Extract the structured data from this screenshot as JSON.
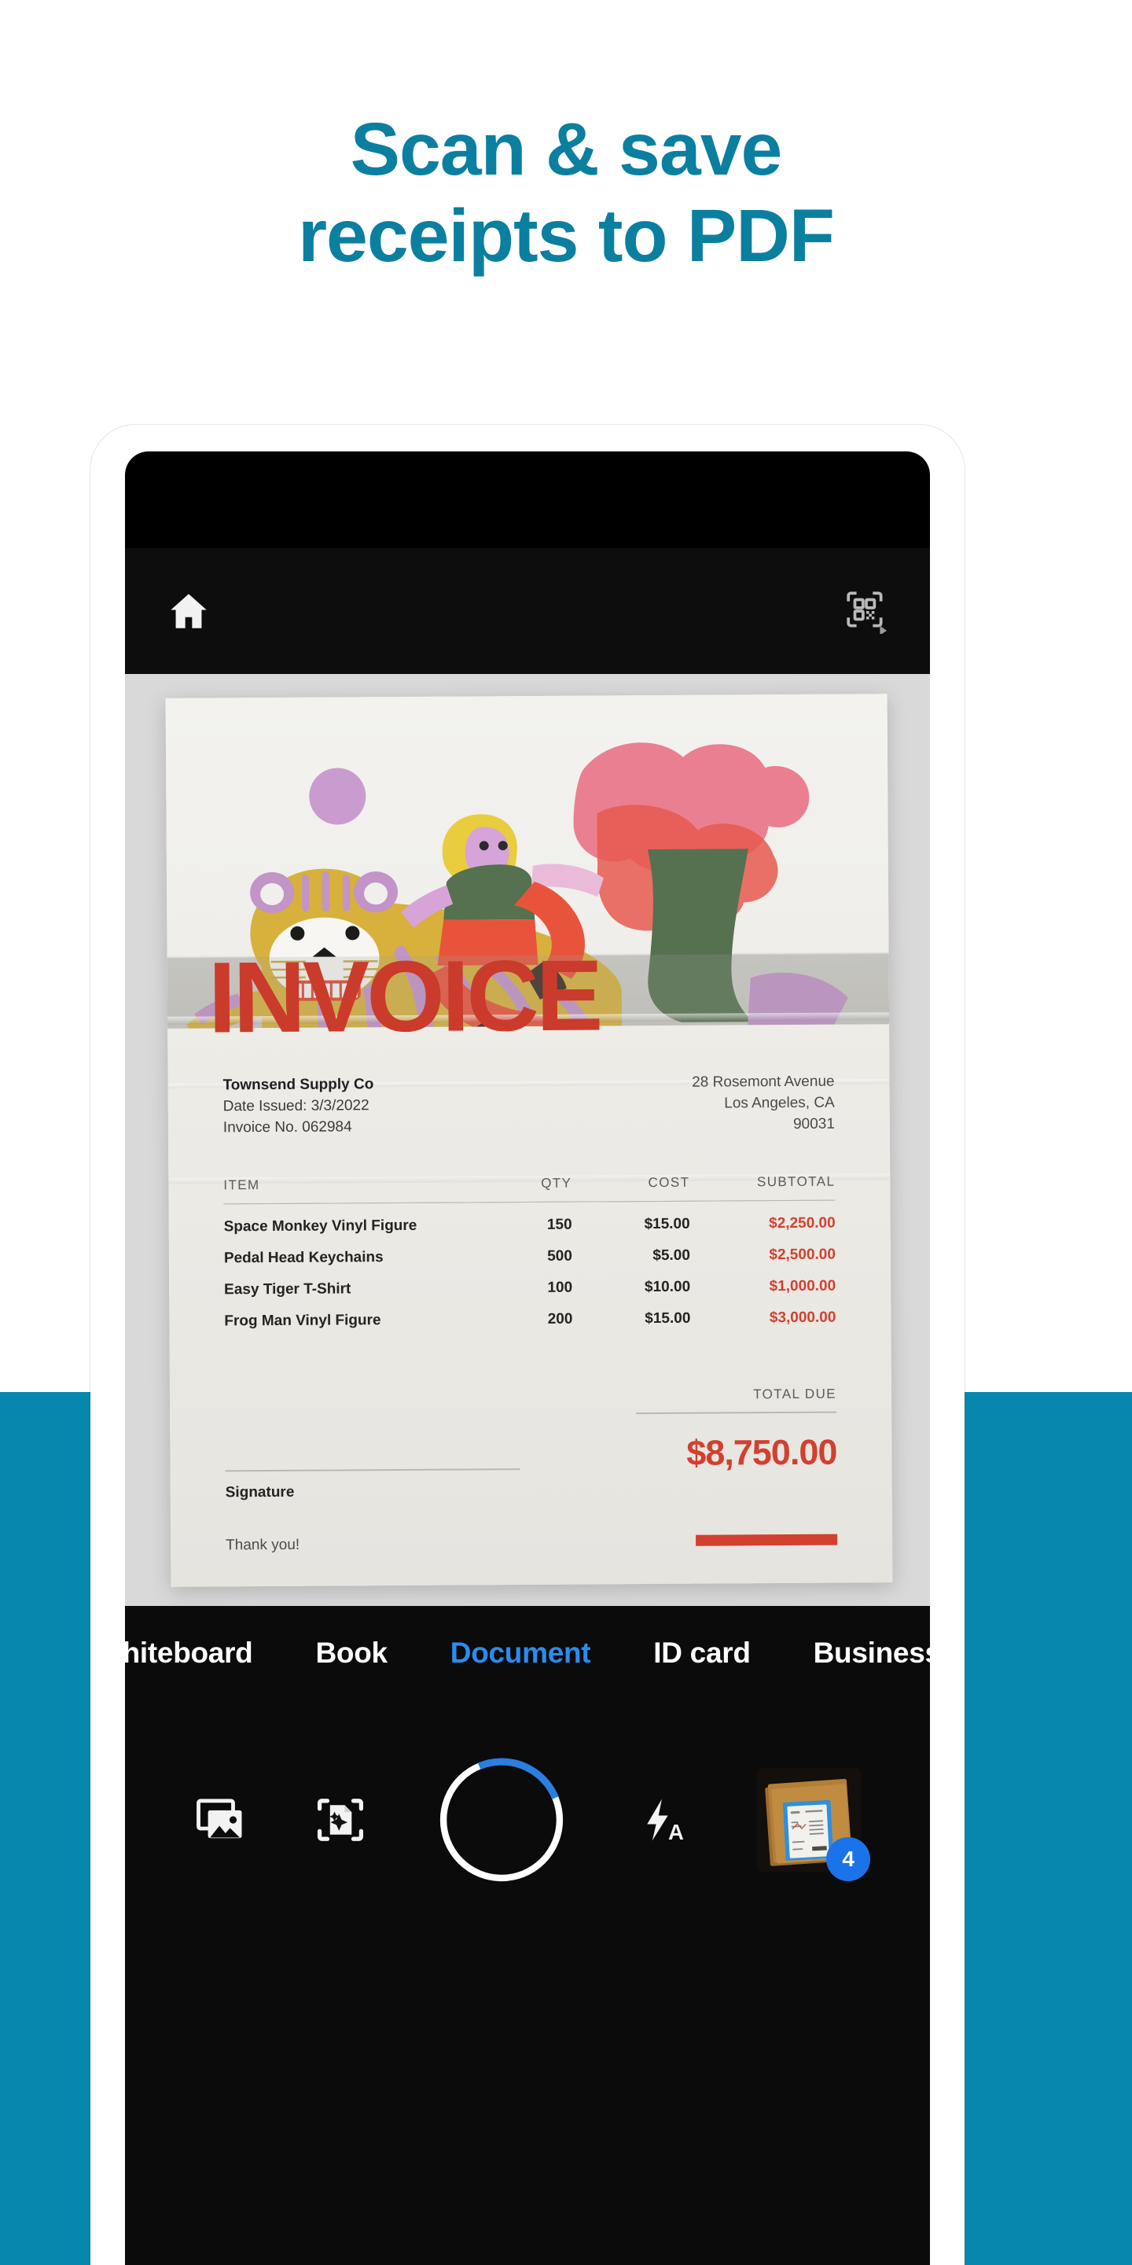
{
  "theme": {
    "accent_teal": "#0787AD",
    "headline_color": "#0B7FA0",
    "invoice_red": "#D2402F",
    "tab_active_blue": "#2A8CEE",
    "badge_blue": "#1A73E8"
  },
  "headline": {
    "line1": "Scan & save",
    "line2": "receipts to PDF"
  },
  "app": {
    "topbar": {
      "home_icon": "home-icon",
      "qr_icon": "qr-scan-icon"
    },
    "mode_tabs": [
      {
        "label": "Whiteboard",
        "active": false
      },
      {
        "label": "Book",
        "active": false
      },
      {
        "label": "Document",
        "active": true
      },
      {
        "label": "ID card",
        "active": false
      },
      {
        "label": "Business c",
        "active": false
      }
    ],
    "toolbar": {
      "gallery_icon": "gallery-icon",
      "auto_enhance_icon": "document-sparkle-scan-icon",
      "shutter_label": "shutter-button",
      "shutter_progress_percent": 25,
      "flash_icon": "flash-auto-icon",
      "flash_mode_letter": "A",
      "thumbnail_icon": "last-capture-thumbnail",
      "thumbnail_badge_count": "4"
    }
  },
  "invoice": {
    "title": "INVOICE",
    "seller": {
      "company": "Townsend Supply Co",
      "date_issued": "Date Issued: 3/3/2022",
      "invoice_no": "Invoice No. 062984"
    },
    "address": {
      "line1": "28 Rosemont Avenue",
      "line2": "Los Angeles, CA",
      "line3": "90031"
    },
    "table": {
      "headers": [
        "ITEM",
        "QTY",
        "COST",
        "SUBTOTAL"
      ],
      "rows": [
        {
          "item": "Space Monkey Vinyl Figure",
          "qty": "150",
          "cost": "$15.00",
          "subtotal": "$2,250.00"
        },
        {
          "item": "Pedal Head Keychains",
          "qty": "500",
          "cost": "$5.00",
          "subtotal": "$2,500.00"
        },
        {
          "item": "Easy Tiger T-Shirt",
          "qty": "100",
          "cost": "$10.00",
          "subtotal": "$1,000.00"
        },
        {
          "item": "Frog Man Vinyl Figure",
          "qty": "200",
          "cost": "$15.00",
          "subtotal": "$3,000.00"
        }
      ]
    },
    "total_due_label": "TOTAL DUE",
    "total_due_value": "$8,750.00",
    "signature_label": "Signature",
    "thanks": "Thank you!"
  }
}
